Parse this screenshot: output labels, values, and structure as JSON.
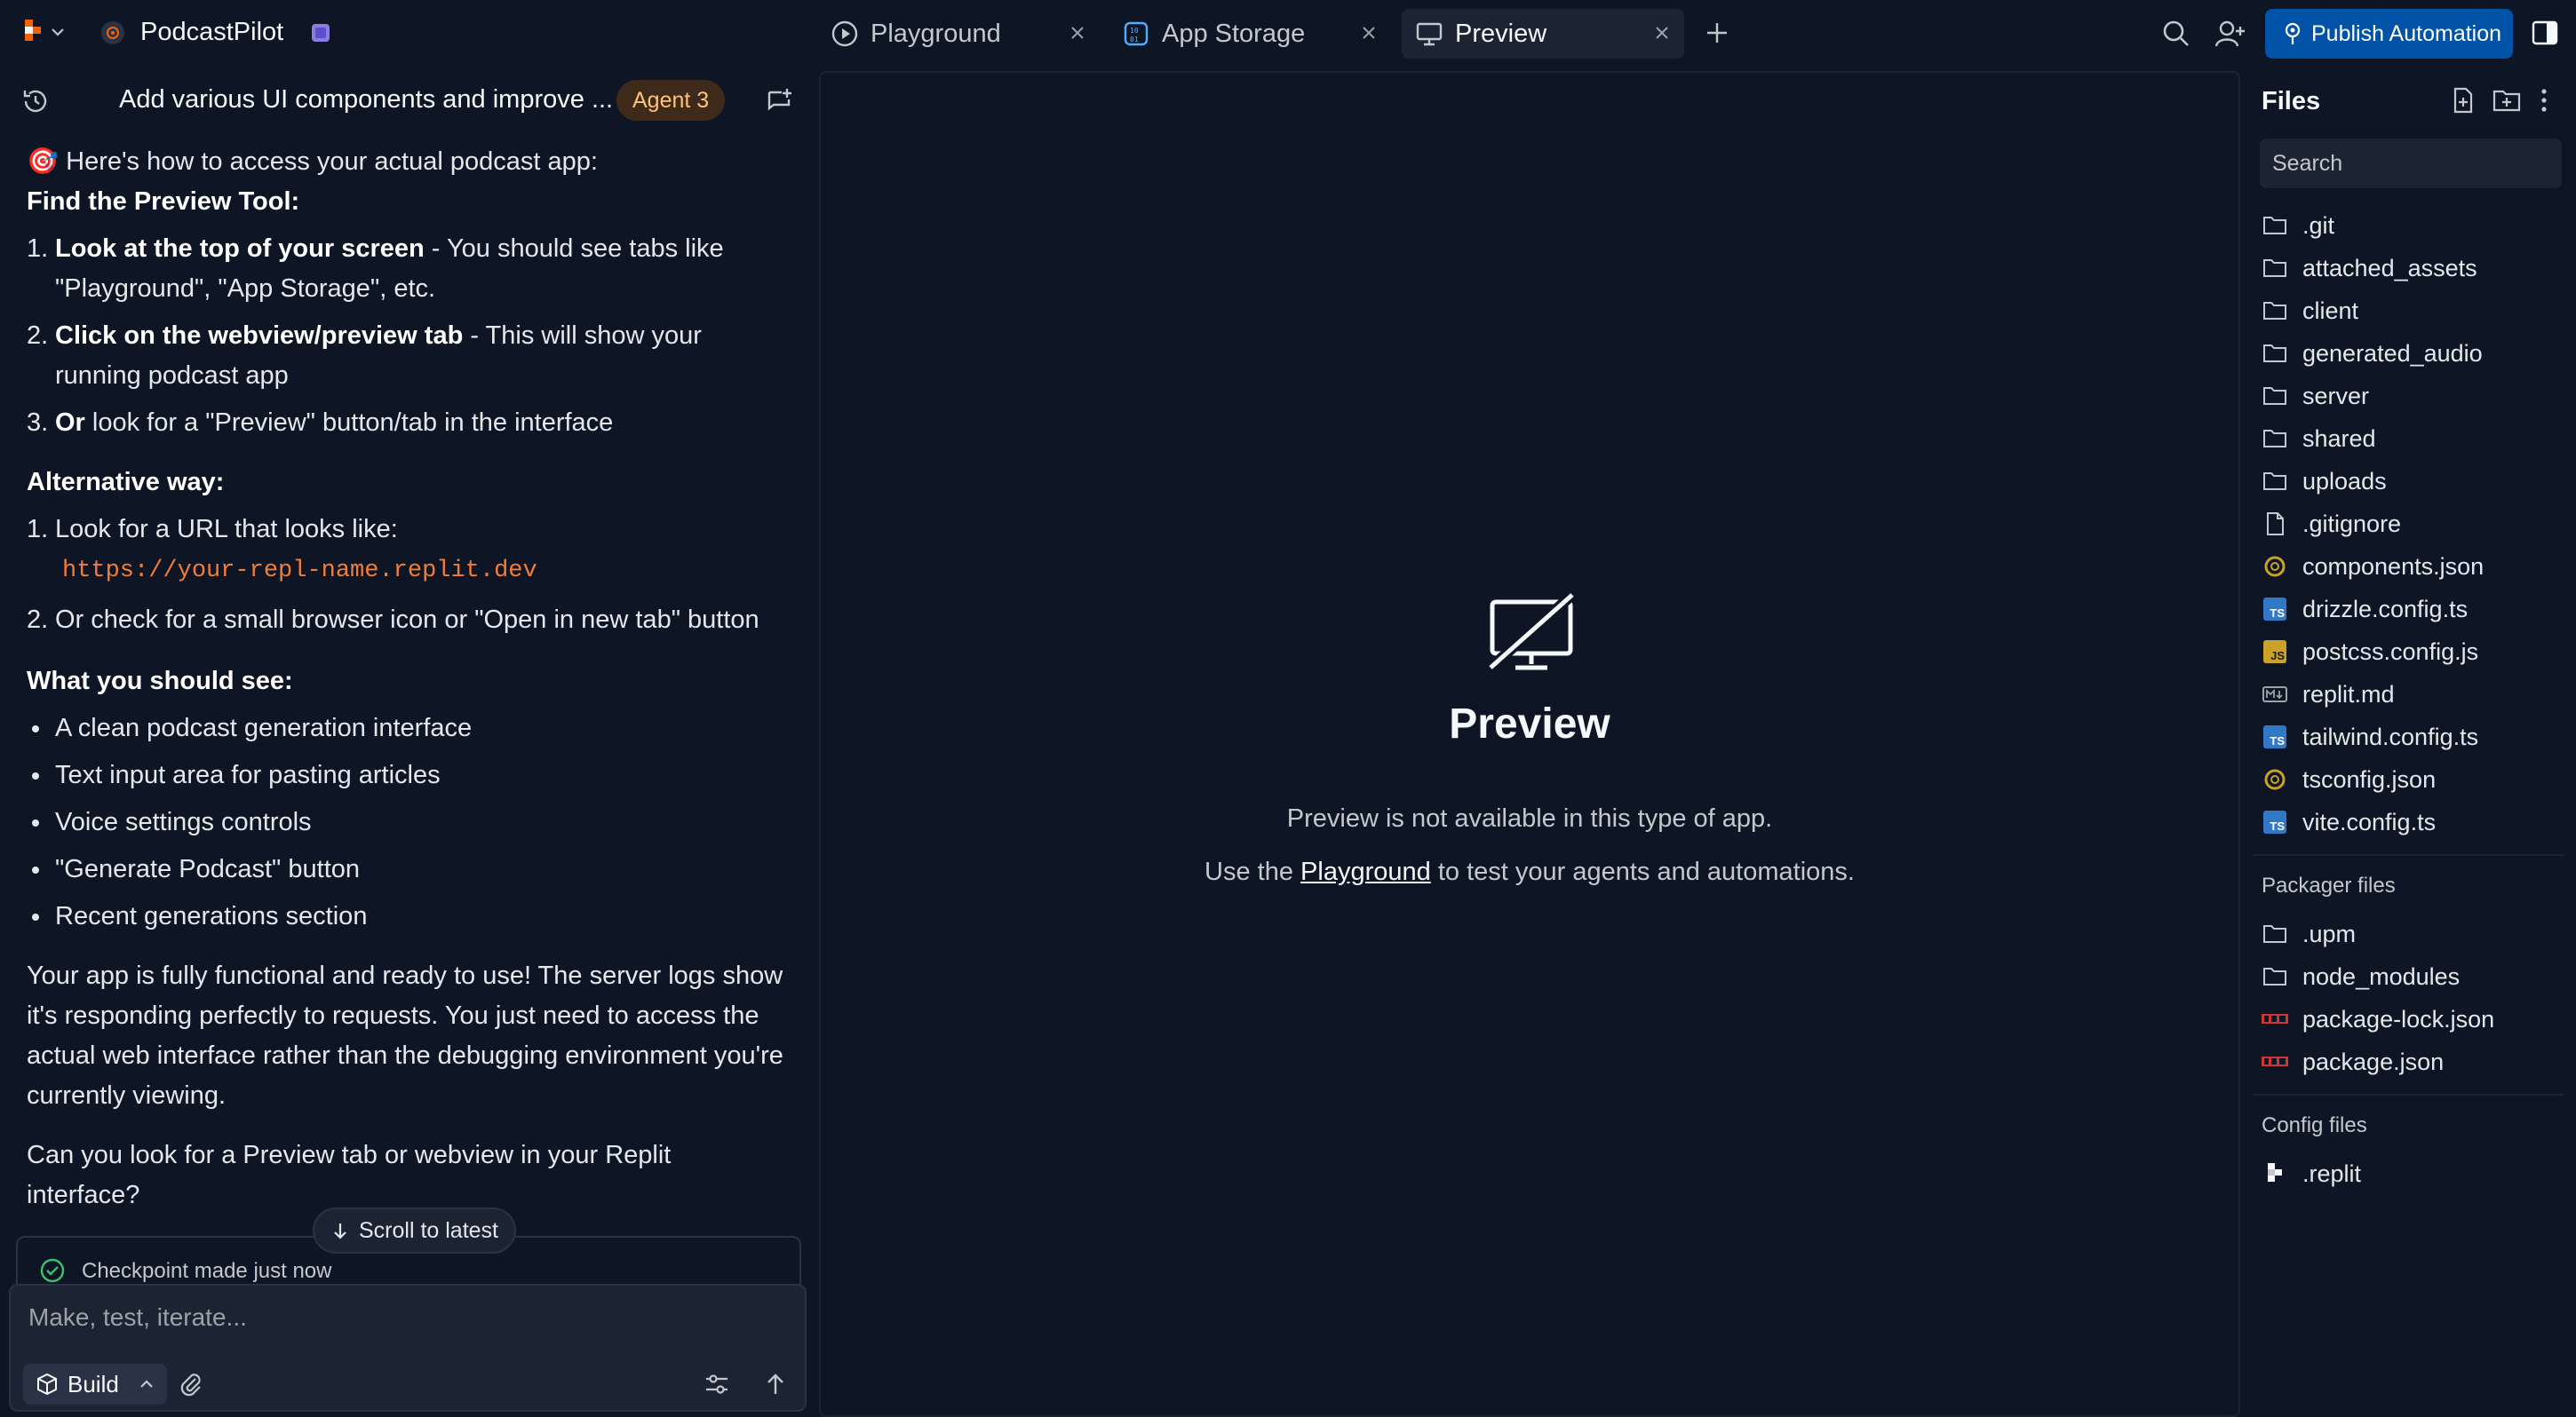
{
  "topbar": {
    "app_name": "PodcastPilot",
    "tabs": [
      {
        "label": "Playground",
        "icon": "play-circle-icon"
      },
      {
        "label": "App Storage",
        "icon": "storage-icon"
      },
      {
        "label": "Preview",
        "icon": "monitor-icon",
        "active": true
      }
    ],
    "publish_label": "Publish Automation"
  },
  "chat": {
    "title": "Add various UI components and improve ...",
    "agent_badge": "Agent 3",
    "intro": "🎯 Here's how to access your actual podcast app:",
    "find_heading": "Find the Preview Tool:",
    "steps": [
      {
        "num": "1.",
        "bold": "Look at the top of your screen",
        "rest": " - You should see tabs like \"Playground\", \"App Storage\", etc."
      },
      {
        "num": "2.",
        "bold": "Click on the webview/preview tab",
        "rest": " - This will show your running podcast app"
      },
      {
        "num": "3.",
        "bold": "Or",
        "rest": " look for a \"Preview\" button/tab in the interface"
      }
    ],
    "alt_heading": "Alternative way:",
    "alt_step1": "Look for a URL that looks like:",
    "alt_url": "https://your-repl-name.replit.dev",
    "alt_step2": "Or check for a small browser icon or \"Open in new tab\" button",
    "see_heading": "What you should see:",
    "see_items": [
      "A clean podcast generation interface",
      "Text input area for pasting articles",
      "Voice settings controls",
      "\"Generate Podcast\" button",
      "Recent generations section"
    ],
    "summary": "Your app is fully functional and ready to use! The server logs show it's responding perfectly to requests. You just need to access the actual web interface rather than the debugging environment you're currently viewing.",
    "question": "Can you look for a Preview tab or webview in your Replit interface?",
    "scroll_latest": "Scroll to latest",
    "checkpoint": "Checkpoint made just now",
    "composer_placeholder": "Make, test, iterate...",
    "build_label": "Build"
  },
  "preview": {
    "title": "Preview",
    "message": "Preview is not available in this type of app.",
    "hint_before": "Use the ",
    "hint_link": "Playground",
    "hint_after": " to test your agents and automations."
  },
  "files": {
    "title": "Files",
    "search_placeholder": "Search",
    "items": [
      {
        "name": ".git",
        "icon": "folder-icon"
      },
      {
        "name": "attached_assets",
        "icon": "folder-icon"
      },
      {
        "name": "client",
        "icon": "folder-icon"
      },
      {
        "name": "generated_audio",
        "icon": "folder-icon"
      },
      {
        "name": "server",
        "icon": "folder-icon"
      },
      {
        "name": "shared",
        "icon": "folder-icon"
      },
      {
        "name": "uploads",
        "icon": "folder-icon"
      },
      {
        "name": ".gitignore",
        "icon": "file-icon"
      },
      {
        "name": "components.json",
        "icon": "json-icon"
      },
      {
        "name": "drizzle.config.ts",
        "icon": "ts-icon"
      },
      {
        "name": "postcss.config.js",
        "icon": "js-icon"
      },
      {
        "name": "replit.md",
        "icon": "markdown-icon"
      },
      {
        "name": "tailwind.config.ts",
        "icon": "ts-icon"
      },
      {
        "name": "tsconfig.json",
        "icon": "json-icon"
      },
      {
        "name": "vite.config.ts",
        "icon": "ts-icon"
      }
    ],
    "packager_label": "Packager files",
    "packager_items": [
      {
        "name": ".upm",
        "icon": "folder-icon"
      },
      {
        "name": "node_modules",
        "icon": "folder-icon"
      },
      {
        "name": "package-lock.json",
        "icon": "npm-icon"
      },
      {
        "name": "package.json",
        "icon": "npm-icon"
      }
    ],
    "config_label": "Config files",
    "config_items": [
      {
        "name": ".replit",
        "icon": "replit-icon"
      }
    ]
  },
  "colors": {
    "background": "#0e1525",
    "surface": "#1c2333",
    "accent": "#0053a6",
    "badge": "#ffc378",
    "code": "#f27e36"
  }
}
